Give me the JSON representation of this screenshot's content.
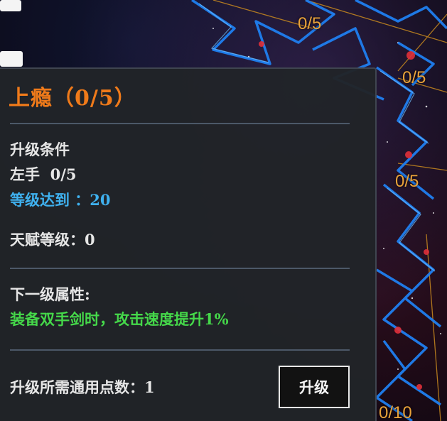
{
  "background": {
    "node_counts": [
      "0/5",
      "0/5",
      "0/5",
      "0/10"
    ]
  },
  "tooltip": {
    "title": "上瘾（0/5）",
    "requirements": {
      "heading": "升级条件",
      "left_hand": "左手  0/5",
      "level_req": "等级达到 ：20",
      "talent_level": "天赋等级：0"
    },
    "next_level": {
      "heading": "下一级属性:",
      "effect": "装备双手剑时，攻击速度提升1%"
    },
    "cost": {
      "label": "升级所需通用点数：1"
    },
    "upgrade_button": "升级"
  },
  "colors": {
    "title": "#ef7a1a",
    "level_requirement": "#3fb1ef",
    "effect": "#45d84a",
    "node_count": "#e9a23a"
  }
}
